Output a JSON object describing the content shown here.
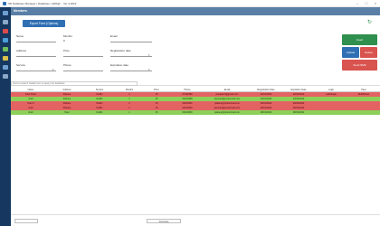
{
  "window": {
    "title": "SD Database Manager | Database: sdDb@... Ver 3.2022"
  },
  "colors": {
    "sidebar": "#16375f",
    "header": "#5a7fa6",
    "primary": "#2f6fb3",
    "success": "#2f8f4e",
    "danger": "#d9534f",
    "row_red": "#e36363",
    "row_green": "#8cd05a"
  },
  "header": {
    "title": "Members"
  },
  "toolbar": {
    "export_label": "Export Form (Options)"
  },
  "form": {
    "name_label": "Name",
    "months_label": "Months",
    "months_value": "0",
    "email_label": "Email",
    "address_label": "Address",
    "price_label": "Price",
    "registration_date_label": "Registration date",
    "service_label": "Service",
    "phone_label": "Phone",
    "expiration_date_label": "Expiration date"
  },
  "actions": {
    "insert": "Insert",
    "update": "Update",
    "delete": "Delete",
    "send_sms": "Send SMS"
  },
  "search": {
    "placeholder": "Insert a search header item to query the database"
  },
  "table": {
    "columns": [
      "Name",
      "Address",
      "Service",
      "Months",
      "Price",
      "Phone",
      "Email",
      "Registration Date",
      "Expiration Date",
      "Login",
      "Pass"
    ],
    "rows": [
      {
        "status": "red",
        "cells": [
          "Paul Paviri",
          "Palrace",
          "Netflix",
          "1",
          "15",
          "07442399",
          "paulpaviri@gmail.com",
          "22/01/2022",
          "22/02/2022",
          "netflixlogin",
          "NetflixPass"
        ]
      },
      {
        "status": "green",
        "cells": [
          "Andr",
          "Palrace",
          "Netflix",
          "1",
          "15",
          "00143398",
          "alemani@protonmail.com",
          "24/01/2022",
          "24/02/2022",
          "",
          ""
        ]
      },
      {
        "status": "red",
        "cells": [
          "Paul II",
          "Palrace",
          "Netflix",
          "1",
          "15",
          "00143300",
          "palrace@protonmail.com",
          "26/01/2022",
          "26/02/2022",
          "",
          ""
        ]
      },
      {
        "status": "red",
        "cells": [
          "Andr",
          "Palrace",
          "Netflix",
          "1",
          "15",
          "00143300",
          "alemani@protonmail.com",
          "26/01/2022",
          "26/02/2022",
          "",
          ""
        ]
      },
      {
        "status": "green",
        "cells": [
          "Andr",
          "Paul",
          "Netflix",
          "1",
          "15",
          "00143300",
          "palrace@protonmail.com",
          "28/01/2022",
          "28/02/2022",
          "",
          ""
        ]
      }
    ]
  },
  "footer": {
    "center_label": "Schedule"
  }
}
